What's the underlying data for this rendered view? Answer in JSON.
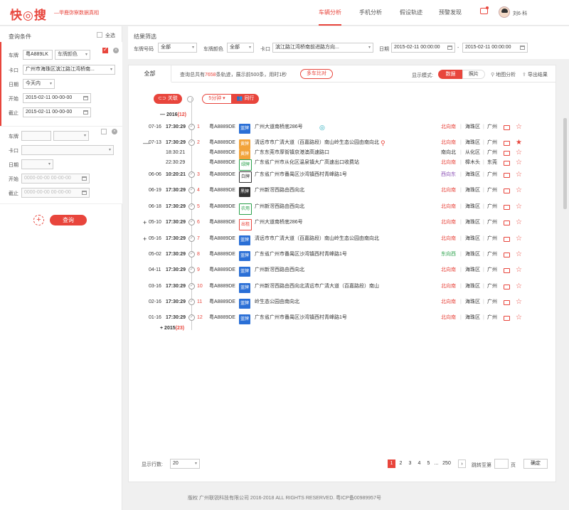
{
  "header": {
    "logo": "快◎搜",
    "slogan": "—甲鹿弥察数据真相",
    "nav": [
      "车辆分析",
      "手机分析",
      "假设轨迹",
      "预警发现"
    ],
    "user": "刘6·科"
  },
  "sidebar": {
    "title": "查询条件",
    "select_all": "全选",
    "group1": {
      "plate_label": "车牌",
      "plate": "粤A889LK",
      "color": "车牌颜色",
      "gate_label": "卡口",
      "gate": "广州市海珠区滨江路江湾桥南...",
      "date_label": "日期",
      "date": "今天内",
      "start_label": "开始",
      "start": "2015-02-11  00-00-00",
      "end_label": "截止",
      "end": "2015-02-11  00-00-00"
    },
    "group2": {
      "plate_label": "车牌",
      "gate_label": "卡口",
      "date_label": "日期",
      "start_label": "开始",
      "start": "0000-00-00  00-00-00",
      "end_label": "截止",
      "end": "0000-00-00  00-00-00"
    },
    "query_button": "查询",
    "add": "+"
  },
  "filter": {
    "title": "结果筛选",
    "plate_label": "车牌号码",
    "plate": "全部",
    "color_label": "车牌颜色",
    "color": "全部",
    "gate_label": "卡口",
    "gate": "滨江路江湾桥南前进路方向...",
    "date_label": "日期",
    "date_from": "2015-02-11  00:00:00",
    "date_sep": "-",
    "date_to": "2015-02-11  00:00:00"
  },
  "results": {
    "tab": "全部",
    "summary_pre": "查询总共有",
    "count": "7658",
    "summary_post": "条轨迹，展示前500条，用时1秒",
    "multi_compare": "多车比对",
    "mode_label": "显示模式:",
    "mode_data": "数据",
    "mode_photo": "照片",
    "map_analysis": "地图分析",
    "export": "导出结果",
    "relate": "关联",
    "interval": "5分钟",
    "companion": "同行",
    "year2016": "2016",
    "year2016_count": "(12)",
    "year2015": "2015",
    "year2015_count": "(23)",
    "rows": [
      {
        "date": "07-16",
        "time": "17:30:29",
        "n": "1",
        "plate": "粤A8889DE",
        "tag": "蓝牌",
        "tagc": "tblue",
        "addr": "广州大道南桥底286号",
        "dir": "北向南",
        "area": "海珠区",
        "city": "广州",
        "dirc": "#e8453c"
      },
      {
        "date": "07-13",
        "time": "17:30:29",
        "n": "2",
        "plate": "粤A8889DE",
        "tag": "黄牌",
        "tagc": "torange",
        "addr": "清远市市广清大道（百嘉路段）南山岭生态公园由南向北",
        "dir": "北向南",
        "area": "海珠区",
        "city": "广州",
        "dirc": "#e8453c"
      },
      {
        "date": "",
        "time": "18:30:21",
        "n": "",
        "plate": "粤A8889DE",
        "tag": "黄牌",
        "tagc": "torange",
        "addr": "广东东莞市厚街镇京港澳高速路口",
        "dir": "南向北",
        "area": "从化区",
        "city": "广州",
        "dirc": "#333"
      },
      {
        "date": "",
        "time": "22:30:29",
        "n": "",
        "plate": "粤A8889DE",
        "tag": "绿牌",
        "tagc": "tgreen",
        "addr": "广东省广州市从化区温泉镇大广高速出口收费站",
        "dir": "北向南",
        "area": "樟木头",
        "city": "东莞",
        "dirc": "#e8453c"
      },
      {
        "date": "06-06",
        "time": "10:20:21",
        "n": "3",
        "plate": "粤A8889DE",
        "tag": "白牌",
        "tagc": "tblack",
        "addr": "广东省广州市番禺区沙湾镇西村青峰路1号",
        "dir": "西向东",
        "area": "海珠区",
        "city": "广州",
        "dirc": "#8a4fb5"
      },
      {
        "date": "06-19",
        "time": "17:30:29",
        "n": "4",
        "plate": "粤A8889DE",
        "tag": "黑牌",
        "tagc": "tdark",
        "addr": "广州新滘西路由西向北",
        "dir": "北向南",
        "area": "海珠区",
        "city": "广州",
        "dirc": "#e8453c"
      },
      {
        "date": "06-18",
        "time": "17:30:29",
        "n": "5",
        "plate": "粤A8889DE",
        "tag": "农用",
        "tagc": "tgreen",
        "addr": "广州新滘西路由西向北",
        "dir": "北向南",
        "area": "海珠区",
        "city": "广州",
        "dirc": "#e8453c"
      },
      {
        "date": "05-10",
        "time": "17:30:29",
        "n": "6",
        "plate": "粤A8889DE",
        "tag": "出租",
        "tagc": "tred",
        "addr": "广州大道南桥底286号",
        "dir": "北向南",
        "area": "海珠区",
        "city": "广州",
        "dirc": "#e8453c"
      },
      {
        "date": "05-16",
        "time": "17:30:29",
        "n": "7",
        "plate": "粤A8889DE",
        "tag": "蓝牌",
        "tagc": "tblue",
        "addr": "清远市市广清大道（百嘉路段）南山岭生态公园由南向北",
        "dir": "北向南",
        "area": "海珠区",
        "city": "广州",
        "dirc": "#e8453c"
      },
      {
        "date": "05-02",
        "time": "17:30:29",
        "n": "8",
        "plate": "粤A8889DE",
        "tag": "蓝牌",
        "tagc": "tblue",
        "addr": "广东省广州市番禺区沙湾镇西村青峰路1号",
        "dir": "东向西",
        "area": "海珠区",
        "city": "广州",
        "dirc": "#29a04a"
      },
      {
        "date": "04-11",
        "time": "17:30:29",
        "n": "9",
        "plate": "粤A8889DE",
        "tag": "蓝牌",
        "tagc": "tblue",
        "addr": "广州新滘西路由西向北",
        "dir": "北向南",
        "area": "海珠区",
        "city": "广州",
        "dirc": "#e8453c"
      },
      {
        "date": "03-16",
        "time": "17:30:29",
        "n": "10",
        "plate": "粤A8889DE",
        "tag": "蓝牌",
        "tagc": "tblue",
        "addr": "广州新滘西路由西向北清远市广清大道（百嘉路段）南山",
        "dir": "北向南",
        "area": "海珠区",
        "city": "广州",
        "dirc": "#e8453c"
      },
      {
        "date": "02-16",
        "time": "17:30:29",
        "n": "11",
        "plate": "粤A8889DE",
        "tag": "蓝牌",
        "tagc": "tblue",
        "addr": "岭生态公园由南向北",
        "dir": "北向南",
        "area": "海珠区",
        "city": "广州",
        "dirc": "#e8453c"
      },
      {
        "date": "01-16",
        "time": "17:30:29",
        "n": "12",
        "plate": "粤A8889DE",
        "tag": "蓝牌",
        "tagc": "tblue",
        "addr": "广东省广州市番禺区沙湾镇西村青峰路1号",
        "dir": "北向南",
        "area": "海珠区",
        "city": "广州",
        "dirc": "#e8453c"
      }
    ],
    "pager": {
      "rows_label": "显示行数:",
      "rows_value": "20",
      "pages": [
        "1",
        "2",
        "3",
        "4",
        "5"
      ],
      "ellipsis": "...",
      "last": "250",
      "next": "›",
      "jump_label": "跳转至第",
      "page_unit": "页",
      "confirm": "确定"
    }
  },
  "footer": "版权 广州联锐科技有限公司 2016-2018 ALL RIGHTS RESERVED. 粤ICP备00989957号"
}
